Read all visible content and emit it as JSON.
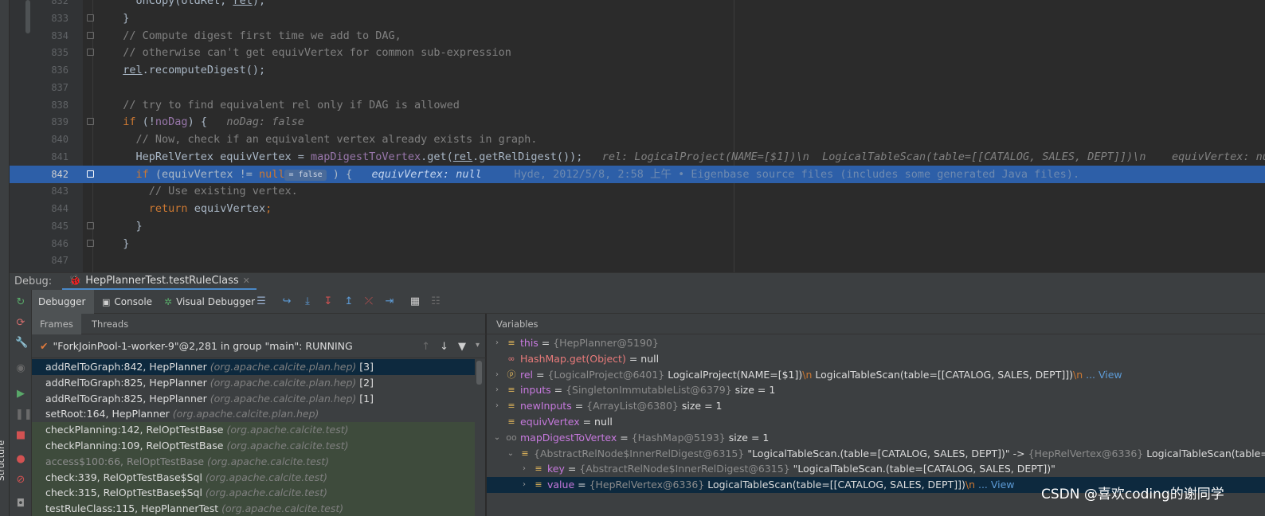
{
  "editor": {
    "lines": [
      {
        "num": "832",
        "code": "    onCopy(oldRel, rel);",
        "segs": [
          {
            "t": "    onCopy(oldRel, ",
            "c": ""
          },
          {
            "t": "rel",
            "c": "un"
          },
          {
            "t": ");",
            "c": ""
          }
        ]
      },
      {
        "num": "833",
        "segs": [
          {
            "t": "  }",
            "c": ""
          }
        ]
      },
      {
        "num": "834",
        "segs": [
          {
            "t": "  // Compute digest first time we add to DAG,",
            "c": "cm"
          }
        ]
      },
      {
        "num": "835",
        "segs": [
          {
            "t": "  // otherwise can't get equivVertex for common sub-expression",
            "c": "cm"
          }
        ]
      },
      {
        "num": "836",
        "segs": [
          {
            "t": "  ",
            "c": ""
          },
          {
            "t": "rel",
            "c": "un"
          },
          {
            "t": ".recomputeDigest();",
            "c": ""
          }
        ]
      },
      {
        "num": "837",
        "segs": []
      },
      {
        "num": "838",
        "segs": [
          {
            "t": "  // try to find equivalent rel only if DAG is allowed",
            "c": "cm"
          }
        ]
      },
      {
        "num": "839",
        "segs": [
          {
            "t": "  ",
            "c": ""
          },
          {
            "t": "if",
            "c": "kw"
          },
          {
            "t": " (!",
            "c": ""
          },
          {
            "t": "noDag",
            "c": "fld"
          },
          {
            "t": ") {   ",
            "c": ""
          },
          {
            "t": "noDag: false",
            "c": "hint"
          }
        ]
      },
      {
        "num": "840",
        "segs": [
          {
            "t": "    // Now, check if an equivalent vertex already exists in graph.",
            "c": "cm"
          }
        ]
      },
      {
        "num": "841",
        "segs": [
          {
            "t": "    HepRelVertex equivVertex = ",
            "c": ""
          },
          {
            "t": "mapDigestToVertex",
            "c": "fld"
          },
          {
            "t": ".get(",
            "c": ""
          },
          {
            "t": "rel",
            "c": "un"
          },
          {
            "t": ".getRelDigest());   ",
            "c": ""
          },
          {
            "t": "rel: LogicalProject(NAME=[$1])\\n  LogicalTableScan(table=[[CATALOG, SALES, DEPT]])\\n    equivVertex: null",
            "c": "hint"
          }
        ]
      },
      {
        "num": "842",
        "cur": true,
        "segs": [
          {
            "t": "    ",
            "c": ""
          },
          {
            "t": "if",
            "c": "kw"
          },
          {
            "t": " (equivVertex != ",
            "c": ""
          },
          {
            "t": "null",
            "c": "kw"
          },
          {
            "t": "",
            "c": "chip",
            "chip": "= false"
          },
          {
            "t": " ) {   ",
            "c": ""
          },
          {
            "t": "equivVertex: null",
            "c": "hint"
          },
          {
            "t": "     Hyde, 2012/5/8, 2:58 上午 • Eigenbase source files (includes some generated Java files).",
            "c": "blame"
          }
        ]
      },
      {
        "num": "843",
        "segs": [
          {
            "t": "      // Use existing vertex.",
            "c": "cm"
          }
        ]
      },
      {
        "num": "844",
        "segs": [
          {
            "t": "      ",
            "c": ""
          },
          {
            "t": "return",
            "c": "kw"
          },
          {
            "t": " equivVertex",
            "c": ""
          },
          {
            "t": ";",
            "c": "kw"
          }
        ]
      },
      {
        "num": "845",
        "segs": [
          {
            "t": "    }",
            "c": ""
          }
        ]
      },
      {
        "num": "846",
        "segs": [
          {
            "t": "  }",
            "c": ""
          }
        ]
      },
      {
        "num": "847",
        "segs": []
      }
    ]
  },
  "structure_label": "Structure",
  "debug": {
    "title": "Debug:",
    "session_tab": "HepPlannerTest.testRuleClass",
    "tabs": {
      "debugger": "Debugger",
      "console": "Console",
      "visual": "Visual Debugger"
    },
    "frames_tab": "Frames",
    "threads_tab": "Threads",
    "thread": "\"ForkJoinPool-1-worker-9\"@2,281 in group \"main\": RUNNING",
    "frames": [
      {
        "m": "addRelToGraph:842, HepPlanner ",
        "p": "(org.apache.calcite.plan.hep)",
        "i": " [3]",
        "k": "sel"
      },
      {
        "m": "addRelToGraph:825, HepPlanner ",
        "p": "(org.apache.calcite.plan.hep)",
        "i": " [2]",
        "k": ""
      },
      {
        "m": "addRelToGraph:825, HepPlanner ",
        "p": "(org.apache.calcite.plan.hep)",
        "i": " [1]",
        "k": ""
      },
      {
        "m": "setRoot:164, HepPlanner ",
        "p": "(org.apache.calcite.plan.hep)",
        "i": "",
        "k": ""
      },
      {
        "m": "checkPlanning:142, RelOptTestBase ",
        "p": "(org.apache.calcite.test)",
        "i": "",
        "k": "lib"
      },
      {
        "m": "checkPlanning:109, RelOptTestBase ",
        "p": "(org.apache.calcite.test)",
        "i": "",
        "k": "lib"
      },
      {
        "m": "access$100:66, RelOptTestBase ",
        "p": "(org.apache.calcite.test)",
        "i": "",
        "k": "lib dim"
      },
      {
        "m": "check:339, RelOptTestBase$Sql ",
        "p": "(org.apache.calcite.test)",
        "i": "",
        "k": "lib"
      },
      {
        "m": "check:315, RelOptTestBase$Sql ",
        "p": "(org.apache.calcite.test)",
        "i": "",
        "k": "lib"
      },
      {
        "m": "testRuleClass:115, HepPlannerTest ",
        "p": "(org.apache.calcite.test)",
        "i": "",
        "k": "lib"
      }
    ],
    "variables_label": "Variables",
    "variables": [
      {
        "d": 0,
        "exp": ">",
        "icon": "fld",
        "name": "this",
        "eq": " = ",
        "type": "{HepPlanner@5190}",
        "val": "",
        "link": ""
      },
      {
        "d": 0,
        "exp": "",
        "icon": "watch",
        "name": "HashMap.get(Object)",
        "eq": " = ",
        "type": "",
        "val": "null",
        "link": "",
        "red": true
      },
      {
        "d": 0,
        "exp": ">",
        "icon": "param",
        "name": "rel",
        "eq": " = ",
        "type": "{LogicalProject@6401}",
        "val": " LogicalProject(NAME=[$1])",
        "nl": "\\n",
        "val2": "  LogicalTableScan(table=[[CATALOG, SALES, DEPT]])",
        "nl2": "\\n",
        "link": " ... View"
      },
      {
        "d": 0,
        "exp": ">",
        "icon": "fld",
        "name": "inputs",
        "eq": " = ",
        "type": "{SingletonImmutableList@6379}",
        "val": "  size = 1",
        "link": ""
      },
      {
        "d": 0,
        "exp": ">",
        "icon": "fld",
        "name": "newInputs",
        "eq": " = ",
        "type": "{ArrayList@6380}",
        "val": "  size = 1",
        "link": ""
      },
      {
        "d": 0,
        "exp": "",
        "icon": "fld",
        "name": "equivVertex",
        "eq": " = ",
        "type": "",
        "val": "null",
        "link": ""
      },
      {
        "d": 0,
        "exp": "v",
        "icon": "glasses",
        "name": "mapDigestToVertex",
        "eq": " = ",
        "type": "{HashMap@5193}",
        "val": "  size = 1",
        "link": ""
      },
      {
        "d": 1,
        "exp": "v",
        "icon": "fld",
        "name": "",
        "eq": "",
        "type": "{AbstractRelNode$InnerRelDigest@6315}",
        "val": " \"LogicalTableScan.(table=[CATALOG, SALES, DEPT])\" -> ",
        "type2": "{HepRelVertex@6336}",
        "val2": " LogicalTableScan(table=[",
        "link": "... View"
      },
      {
        "d": 2,
        "exp": ">",
        "icon": "fld",
        "name": "key",
        "eq": " = ",
        "type": "{AbstractRelNode$InnerRelDigest@6315}",
        "val": " \"LogicalTableScan.(table=[CATALOG, SALES, DEPT])\"",
        "link": ""
      },
      {
        "d": 2,
        "exp": ">",
        "icon": "fld",
        "name": "value",
        "eq": " = ",
        "type": "{HepRelVertex@6336}",
        "val": " LogicalTableScan(table=[[CATALOG, SALES, DEPT]])",
        "nl": "\\n",
        "link": " ... View",
        "sel": true
      }
    ]
  },
  "watermark": "CSDN @喜欢coding的谢同学",
  "colors": {
    "accent": "#4a88c7",
    "current_line": "#2d5fa8",
    "selection": "#0d293e"
  }
}
